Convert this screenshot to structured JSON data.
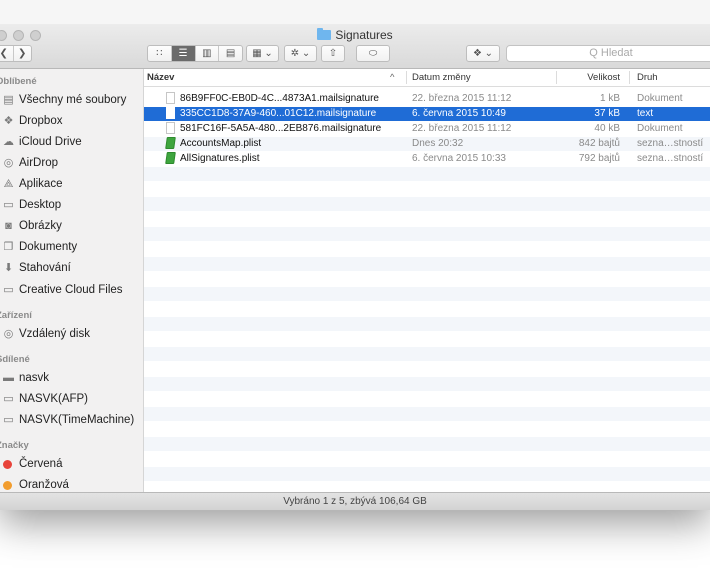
{
  "window": {
    "title": "Signatures",
    "status": "Vybráno 1 z 5, zbývá 106,64 GB"
  },
  "toolbar": {
    "back": "❮",
    "forward": "❯",
    "search_placeholder": "Q Hledat"
  },
  "sidebar": {
    "sections": [
      {
        "title": "Oblíbené",
        "items": [
          {
            "label": "Všechny mé soubory",
            "icon": "all-files-icon"
          },
          {
            "label": "Dropbox",
            "icon": "dropbox-icon"
          },
          {
            "label": "iCloud Drive",
            "icon": "cloud-icon"
          },
          {
            "label": "AirDrop",
            "icon": "airdrop-icon"
          },
          {
            "label": "Aplikace",
            "icon": "applications-icon"
          },
          {
            "label": "Desktop",
            "icon": "desktop-icon"
          },
          {
            "label": "Obrázky",
            "icon": "camera-icon"
          },
          {
            "label": "Dokumenty",
            "icon": "documents-icon"
          },
          {
            "label": "Stahování",
            "icon": "download-icon"
          },
          {
            "label": "Creative Cloud Files",
            "icon": "folder-icon"
          }
        ]
      },
      {
        "title": "Zařízení",
        "items": [
          {
            "label": "Vzdálený disk",
            "icon": "disc-icon"
          }
        ]
      },
      {
        "title": "Sdílené",
        "items": [
          {
            "label": "nasvk",
            "icon": "monitor-icon"
          },
          {
            "label": "NASVK(AFP)",
            "icon": "server-icon"
          },
          {
            "label": "NASVK(TimeMachine)",
            "icon": "server-icon"
          }
        ]
      },
      {
        "title": "Značky",
        "items": [
          {
            "label": "Červená",
            "color": "#e8433a"
          },
          {
            "label": "Oranžová",
            "color": "#f29d2e"
          }
        ]
      }
    ]
  },
  "columns": {
    "name": "Název",
    "date": "Datum změny",
    "size": "Velikost",
    "kind": "Druh",
    "sort_glyph": "^"
  },
  "files": [
    {
      "name": "86B9FF0C-EB0D-4C...4873A1.mailsignature",
      "date": "22. března 2015 11:12",
      "size": "1 kB",
      "kind": "Dokument",
      "selected": false,
      "type": "doc"
    },
    {
      "name": "335CC1D8-37A9-460...01C12.mailsignature",
      "date": "6. června 2015 10:49",
      "size": "37 kB",
      "kind": "text",
      "selected": true,
      "type": "doc"
    },
    {
      "name": "581FC16F-5A5A-480...2EB876.mailsignature",
      "date": "22. března 2015 11:12",
      "size": "40 kB",
      "kind": "Dokument",
      "selected": false,
      "type": "doc"
    },
    {
      "name": "AccountsMap.plist",
      "date": "Dnes 20:32",
      "size": "842 bajtů",
      "kind": "sezna…stností",
      "selected": false,
      "type": "plist"
    },
    {
      "name": "AllSignatures.plist",
      "date": "6. června 2015 10:33",
      "size": "792 bajtů",
      "kind": "sezna…stností",
      "selected": false,
      "type": "plist"
    }
  ],
  "colors": {
    "selection": "#1f6cd6",
    "stripe": "#f3f6fa"
  }
}
